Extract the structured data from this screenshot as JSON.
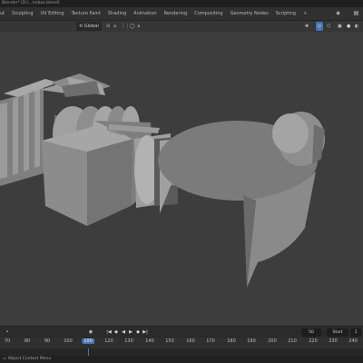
{
  "window": {
    "title": "Blender* [D:\\...\\mbox.blend]"
  },
  "workspace_tabs": [
    {
      "label": "ut"
    },
    {
      "label": "Sculpting"
    },
    {
      "label": "UV Editing"
    },
    {
      "label": "Texture Paint"
    },
    {
      "label": "Shading"
    },
    {
      "label": "Animation"
    },
    {
      "label": "Rendering"
    },
    {
      "label": "Compositing"
    },
    {
      "label": "Geometry Nodes"
    },
    {
      "label": "Scripting"
    },
    {
      "label": "+"
    }
  ],
  "viewport_header": {
    "transform_orientation": "Global",
    "global_arrow": "⌄"
  },
  "timeline": {
    "current_frame": "50",
    "start_label": "Start",
    "start_value": "1",
    "ruler_ticks": [
      "70",
      "80",
      "90",
      "100",
      "110",
      "120",
      "130",
      "140",
      "150",
      "160",
      "170",
      "180",
      "190",
      "200",
      "210",
      "220",
      "230",
      "240"
    ],
    "playhead_frame": "100"
  },
  "status_bar": {
    "text": "Object Context Menu"
  },
  "colors": {
    "accent": "#4772b3",
    "viewport_bg": "#3d3d3d"
  }
}
